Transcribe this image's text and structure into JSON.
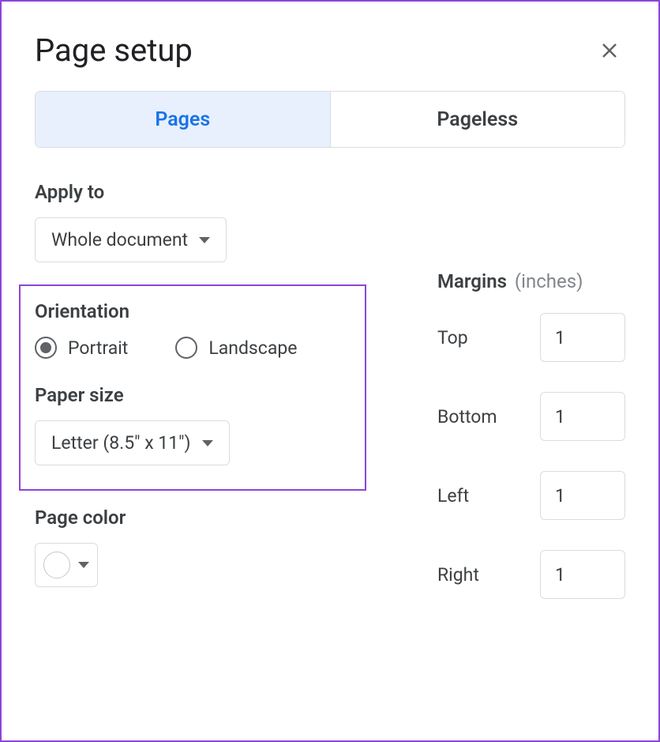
{
  "dialog": {
    "title": "Page setup"
  },
  "tabs": {
    "pages": "Pages",
    "pageless": "Pageless"
  },
  "apply_to": {
    "label": "Apply to",
    "value": "Whole document"
  },
  "orientation": {
    "label": "Orientation",
    "portrait": "Portrait",
    "landscape": "Landscape"
  },
  "paper_size": {
    "label": "Paper size",
    "value": "Letter (8.5\" x 11\")"
  },
  "page_color": {
    "label": "Page color",
    "value_hex": "#ffffff"
  },
  "margins": {
    "label": "Margins",
    "unit": "(inches)",
    "top": {
      "label": "Top",
      "value": "1"
    },
    "bottom": {
      "label": "Bottom",
      "value": "1"
    },
    "left": {
      "label": "Left",
      "value": "1"
    },
    "right": {
      "label": "Right",
      "value": "1"
    }
  }
}
